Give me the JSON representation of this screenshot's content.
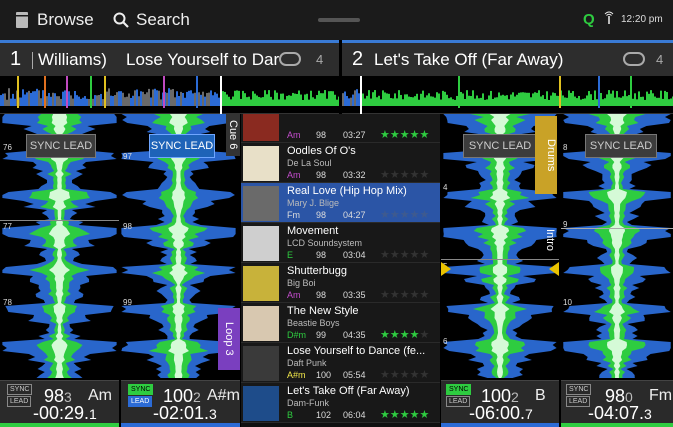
{
  "topbar": {
    "browse_label": "Browse",
    "search_label": "Search",
    "time": "12:20 pm",
    "q_label": "Q"
  },
  "decks": [
    {
      "number": "1",
      "title": "Williams)",
      "title_scroll": "Lose Yourself to Dar",
      "loop_count": "4"
    },
    {
      "number": "2",
      "title": "Let's Take Off (Far Away)",
      "loop_count": "4"
    }
  ],
  "lanes": {
    "lane1": {
      "sync": "SYNC LEAD",
      "beats": [
        "76",
        "77",
        "78"
      ]
    },
    "lane2": {
      "sync": "SYNC LEAD",
      "beats": [
        "97",
        "98",
        "99"
      ],
      "cue_top": "Cue 6",
      "cue_bottom": "Loop 3"
    },
    "lane3": {
      "sync": "SYNC LEAD",
      "beats": [
        "4",
        "5",
        "6"
      ],
      "cue_top": "Drums",
      "cue_bottom": "Intro"
    },
    "lane4": {
      "sync": "SYNC LEAD",
      "beats": [
        "8",
        "9",
        "10"
      ]
    }
  },
  "tracks": [
    {
      "title": "",
      "artist": "",
      "key": "Am",
      "bpm": "98",
      "time": "03:27",
      "rating": 5,
      "key_color": "#c24ccc"
    },
    {
      "title": "Oodles Of O's",
      "artist": "De La Soul",
      "key": "Am",
      "bpm": "98",
      "time": "03:32",
      "rating": 0,
      "key_color": "#c24ccc"
    },
    {
      "title": "Real Love (Hip Hop Mix)",
      "artist": "Mary J. Blige",
      "key": "Fm",
      "bpm": "98",
      "time": "04:27",
      "rating": 0,
      "key_color": "#dddddd"
    },
    {
      "title": "Movement",
      "artist": "LCD Soundsystem",
      "key": "E",
      "bpm": "98",
      "time": "03:04",
      "rating": 0,
      "key_color": "#2ecc40"
    },
    {
      "title": "Shutterbugg",
      "artist": "Big Boi",
      "key": "Am",
      "bpm": "98",
      "time": "03:35",
      "rating": 0,
      "key_color": "#c24ccc"
    },
    {
      "title": "The New Style",
      "artist": "Beastie Boys",
      "key": "D#m",
      "bpm": "99",
      "time": "04:35",
      "rating": 4,
      "key_color": "#2ecc40"
    },
    {
      "title": "Lose Yourself to Dance (fe...",
      "artist": "Daft Punk",
      "key": "A#m",
      "bpm": "100",
      "time": "05:54",
      "rating": 0,
      "key_color": "#f1e74a"
    },
    {
      "title": "Let's Take Off (Far Away)",
      "artist": "Dam-Funk",
      "key": "B",
      "bpm": "102",
      "time": "06:04",
      "rating": 5,
      "key_color": "#2ecc40"
    }
  ],
  "footers": [
    {
      "sync": "SYNC",
      "lead": "LEAD",
      "bpm_main": "98",
      "bpm_dec": "3",
      "key": "Am",
      "key_color": "#c24ccc",
      "time_main": "-00:29.",
      "time_dec": "1"
    },
    {
      "sync": "SYNC",
      "lead": "LEAD",
      "bpm_main": "100",
      "bpm_dec": "2",
      "key": "A#m",
      "key_color": "#f1e74a",
      "time_main": "-02:01.",
      "time_dec": "3"
    },
    {
      "sync": "SYNC",
      "lead": "LEAD",
      "bpm_main": "100",
      "bpm_dec": "2",
      "key": "B",
      "key_color": "#2ecc40",
      "time_main": "-06:00.",
      "time_dec": "7"
    },
    {
      "sync": "SYNC",
      "lead": "LEAD",
      "bpm_main": "98",
      "bpm_dec": "0",
      "key": "Fm",
      "key_color": "#f1e74a",
      "time_main": "-04:07.",
      "time_dec": "3"
    }
  ],
  "colors": {
    "accent": "#3a7bd5",
    "wave_green": "#2ecc40",
    "wave_blue": "#2b6bd6",
    "cue_gold": "#c9a227",
    "cue_purple": "#7a3fbf"
  },
  "icons": [
    "browse-icon",
    "search-icon",
    "q-icon",
    "antenna-icon",
    "loop-icon"
  ]
}
